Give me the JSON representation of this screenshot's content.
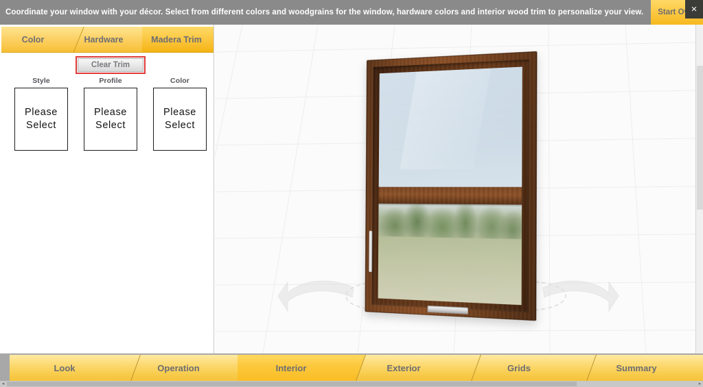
{
  "banner": {
    "message": "Coordinate your window with your décor. Select from different colors and woodgrains for the window, hardware colors and interior wood trim to personalize your view.",
    "start_over_label": "Start Over",
    "close_label": "×",
    "background_color": "#8a8a8a",
    "text_color": "#ffffff"
  },
  "left_panel": {
    "top_tabs": [
      {
        "label": "Color",
        "active": false
      },
      {
        "label": "Hardware",
        "active": false
      },
      {
        "label": "Madera Trim",
        "active": true
      }
    ],
    "clear_trim": {
      "label": "Clear Trim",
      "highlight_color": "#e03a3a"
    },
    "selectors": [
      {
        "label": "Style",
        "value_line_1": "Please",
        "value_line_2": "Select"
      },
      {
        "label": "Profile",
        "value_line_1": "Please",
        "value_line_2": "Select"
      },
      {
        "label": "Color",
        "value_line_1": "Please",
        "value_line_2": "Select"
      }
    ]
  },
  "viewport": {
    "product": "double-hung-window",
    "frame_finish": "dark-walnut-woodgrain",
    "rotate_left_icon": "rotate-left-arrow-icon",
    "rotate_right_icon": "rotate-right-arrow-icon",
    "upper_pane_scene": "sky",
    "lower_pane_scene": "trees-and-meadow",
    "frame_color": "#6e3e1d"
  },
  "bottom_nav": {
    "tabs": [
      {
        "label": "Look",
        "active": false
      },
      {
        "label": "Operation",
        "active": false
      },
      {
        "label": "Interior",
        "active": true
      },
      {
        "label": "Exterior",
        "active": false
      },
      {
        "label": "Grids",
        "active": false
      },
      {
        "label": "Summary",
        "active": false
      }
    ],
    "accent_color": "#f8cc4e",
    "active_color": "#f9bd24",
    "label_color": "#6d6d72"
  },
  "scrollbars": {
    "h_left_arrow": "◂",
    "h_right_arrow": "▸"
  }
}
